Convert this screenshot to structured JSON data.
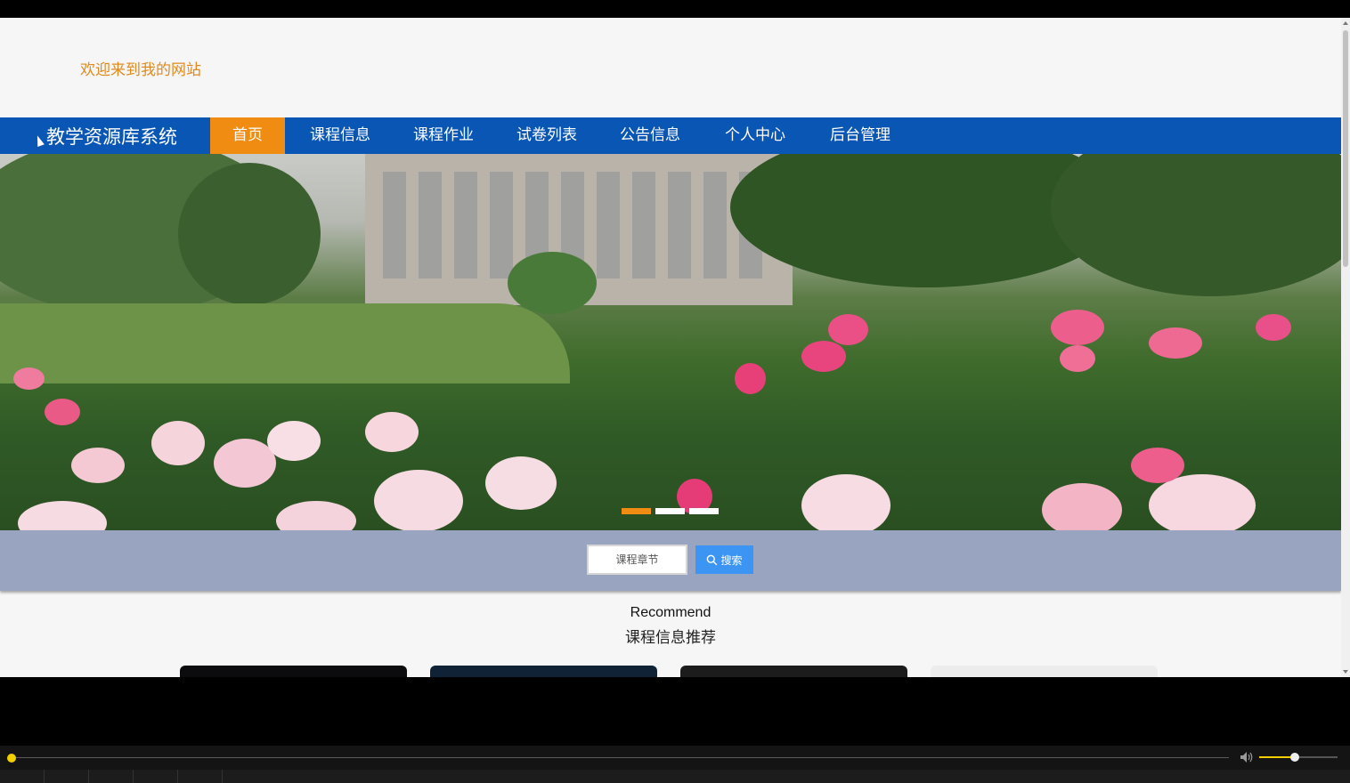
{
  "header": {
    "welcome": "欢迎来到我的网站"
  },
  "navbar": {
    "brand": "教学资源库系统",
    "items": [
      {
        "label": "首页",
        "active": true
      },
      {
        "label": "课程信息",
        "active": false
      },
      {
        "label": "课程作业",
        "active": false
      },
      {
        "label": "试卷列表",
        "active": false
      },
      {
        "label": "公告信息",
        "active": false
      },
      {
        "label": "个人中心",
        "active": false
      },
      {
        "label": "后台管理",
        "active": false
      }
    ]
  },
  "banner": {
    "slide_count": 3,
    "active_slide": 1
  },
  "search": {
    "placeholder": "课程章节",
    "button_label": "搜索"
  },
  "recommend": {
    "title_en": "Recommend",
    "title_cn": "课程信息推荐"
  },
  "player": {
    "progress": 0.0,
    "volume": 0.45
  },
  "colors": {
    "nav_bg": "#0a56b5",
    "accent": "#f08c11",
    "search_btn": "#3c94f3",
    "search_band": "#98a4c0"
  }
}
